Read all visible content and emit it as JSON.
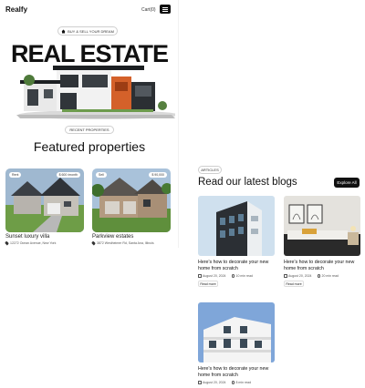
{
  "header": {
    "logo": "Realfy",
    "cart": "Cart(0)"
  },
  "hero": {
    "pill_label": "BUY & SELL YOUR DREAM",
    "title": "REAL ESTATE"
  },
  "featured": {
    "pill_label": "RECENT PROPERTIES",
    "title": "Featured properties",
    "properties": [
      {
        "type": "Rent",
        "price": "$ 600 /month",
        "name": "Sunset luxury villa",
        "address": "12272 Ocean Avenue, New York"
      },
      {
        "type": "Sell",
        "price": "$ 90,000",
        "name": "Parkview estates",
        "address": "3872 Westheimer Rd, Santa Ana, Illinois"
      }
    ]
  },
  "blogs": {
    "pill_label": "ARTICLES",
    "title": "Read our latest blogs",
    "explore_label": "Explore All",
    "items": [
      {
        "title": "Here's how to decorate your new home from scratch",
        "date": "August 20, 2024",
        "read_time": "10 min read",
        "button": "Read more"
      },
      {
        "title": "Here's how to decorate your new home from scratch",
        "date": "August 20, 2024",
        "read_time": "20 min read",
        "button": "Read more"
      },
      {
        "title": "Here's how to decorate your new home from scratch",
        "date": "August 20, 2024",
        "read_time": "8 min read"
      }
    ]
  }
}
